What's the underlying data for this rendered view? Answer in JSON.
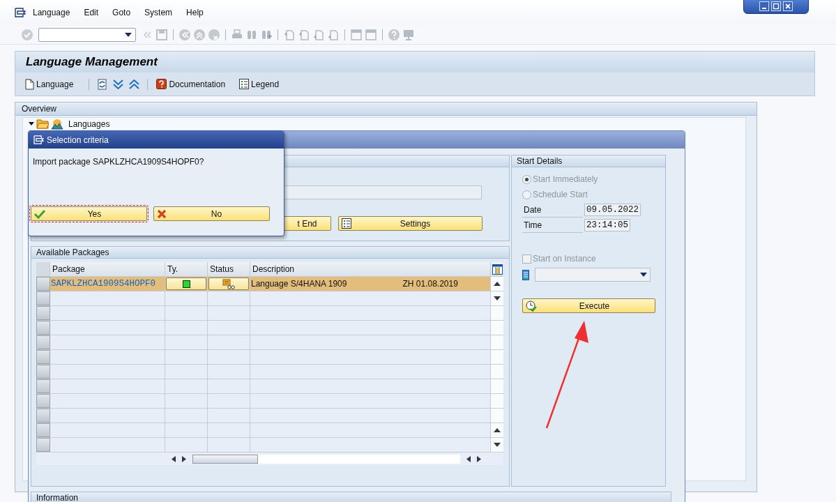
{
  "menu": [
    "Language",
    "Edit",
    "Goto",
    "System",
    "Help"
  ],
  "title": "Language Management",
  "app_toolbar": [
    {
      "kind": "doc",
      "label": "Language"
    },
    {
      "kind": "refresh"
    },
    {
      "kind": "expand"
    },
    {
      "kind": "collapse"
    },
    {
      "kind": "help",
      "label": "Documentation"
    },
    {
      "kind": "legend",
      "label": "Legend"
    }
  ],
  "overview": {
    "title": "Overview",
    "tree": [
      {
        "label": "Languages",
        "expanded": true
      }
    ]
  },
  "import_buttons": [
    {
      "kind": "plain",
      "label": "t End"
    },
    {
      "kind": "legend",
      "label": "Settings"
    }
  ],
  "packages": {
    "title": "Available Packages",
    "columns": [
      "Package",
      "Ty.",
      "Status",
      "Description"
    ],
    "rows": [
      {
        "package": "SAPKLZHCA1909S4HOPF0",
        "description": "Language S/4HANA 1909",
        "column_5": "ZH 01.08.2019",
        "selected": true
      }
    ]
  },
  "start_details": {
    "title": "Start Details",
    "disabled": true,
    "options": [
      {
        "label": "Start Immediately",
        "selected": true
      },
      {
        "label": "Schedule Start",
        "selected": false
      }
    ],
    "fields": [
      {
        "label": "Date",
        "value": "09.05.2022"
      },
      {
        "label": "Time",
        "value": "23:14:05"
      }
    ],
    "instance": {
      "label": "Start on Instance",
      "checked": false
    },
    "execute": "Execute"
  },
  "information": {
    "title": "Information"
  },
  "dialog": {
    "title": "Selection criteria",
    "message": "Import package SAPKLZHCA1909S4HOPF0?",
    "buttons": [
      {
        "kind": "yes",
        "label": "Yes",
        "focused": true
      },
      {
        "kind": "no",
        "label": "No",
        "focused": false
      }
    ]
  }
}
